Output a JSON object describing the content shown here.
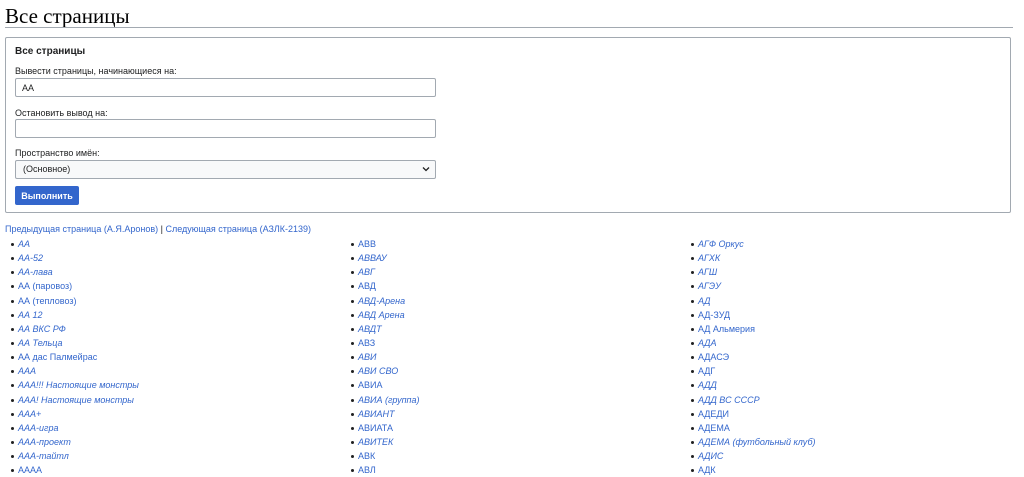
{
  "page": {
    "title": "Все страницы"
  },
  "form": {
    "legend": "Все страницы",
    "from_label": "Вывести страницы, начинающиеся на:",
    "from_value": "АА",
    "to_label": "Остановить вывод на:",
    "to_value": "",
    "namespace_label": "Пространство имён:",
    "namespace_value": "(Основное)",
    "submit_label": "Выполнить"
  },
  "pager": {
    "prev": "Предыдущая страница (А.Я.Аронов)",
    "separator": " | ",
    "next": "Следующая страница (АЗЛК-2139)"
  },
  "columns": [
    [
      {
        "text": "АА",
        "italic": true
      },
      {
        "text": "АА-52",
        "italic": true
      },
      {
        "text": "АА-лава",
        "italic": true
      },
      {
        "text": "АА (паровоз)",
        "italic": false
      },
      {
        "text": "АА (тепловоз)",
        "italic": false
      },
      {
        "text": "АА 12",
        "italic": true
      },
      {
        "text": "АА ВКС РФ",
        "italic": true
      },
      {
        "text": "АА Тельца",
        "italic": true
      },
      {
        "text": "АА дас Палмейрас",
        "italic": false
      },
      {
        "text": "ААА",
        "italic": true
      },
      {
        "text": "ААА!!! Настоящие монстры",
        "italic": true
      },
      {
        "text": "ААА! Настоящие монстры",
        "italic": true
      },
      {
        "text": "ААА+",
        "italic": true
      },
      {
        "text": "ААА-игра",
        "italic": true
      },
      {
        "text": "ААА-проект",
        "italic": true
      },
      {
        "text": "ААА-тайтл",
        "italic": true
      },
      {
        "text": "АААА",
        "italic": false
      }
    ],
    [
      {
        "text": "АВВ",
        "italic": false
      },
      {
        "text": "АВВАУ",
        "italic": true
      },
      {
        "text": "АВГ",
        "italic": true
      },
      {
        "text": "АВД",
        "italic": false
      },
      {
        "text": "АВД-Арена",
        "italic": true
      },
      {
        "text": "АВД Арена",
        "italic": true
      },
      {
        "text": "АВДТ",
        "italic": true
      },
      {
        "text": "АВЗ",
        "italic": false
      },
      {
        "text": "АВИ",
        "italic": true
      },
      {
        "text": "АВИ СВО",
        "italic": true
      },
      {
        "text": "АВИА",
        "italic": false
      },
      {
        "text": "АВИА (группа)",
        "italic": true
      },
      {
        "text": "АВИАНТ",
        "italic": true
      },
      {
        "text": "АВИАТА",
        "italic": false
      },
      {
        "text": "АВИТЕК",
        "italic": true
      },
      {
        "text": "АВК",
        "italic": false
      },
      {
        "text": "АВЛ",
        "italic": false
      }
    ],
    [
      {
        "text": "АГФ Оркус",
        "italic": true
      },
      {
        "text": "АГХК",
        "italic": true
      },
      {
        "text": "АГШ",
        "italic": true
      },
      {
        "text": "АГЭУ",
        "italic": true
      },
      {
        "text": "АД",
        "italic": true
      },
      {
        "text": "АД-ЗУД",
        "italic": false
      },
      {
        "text": "АД Альмерия",
        "italic": false
      },
      {
        "text": "АДА",
        "italic": true
      },
      {
        "text": "АДАСЭ",
        "italic": false
      },
      {
        "text": "АДГ",
        "italic": false
      },
      {
        "text": "АДД",
        "italic": true
      },
      {
        "text": "АДД ВС СССР",
        "italic": true
      },
      {
        "text": "АДЕДИ",
        "italic": false
      },
      {
        "text": "АДЕМА",
        "italic": false
      },
      {
        "text": "АДЕМА (футбольный клуб)",
        "italic": true
      },
      {
        "text": "АДИС",
        "italic": true
      },
      {
        "text": "АДК",
        "italic": false
      }
    ]
  ]
}
